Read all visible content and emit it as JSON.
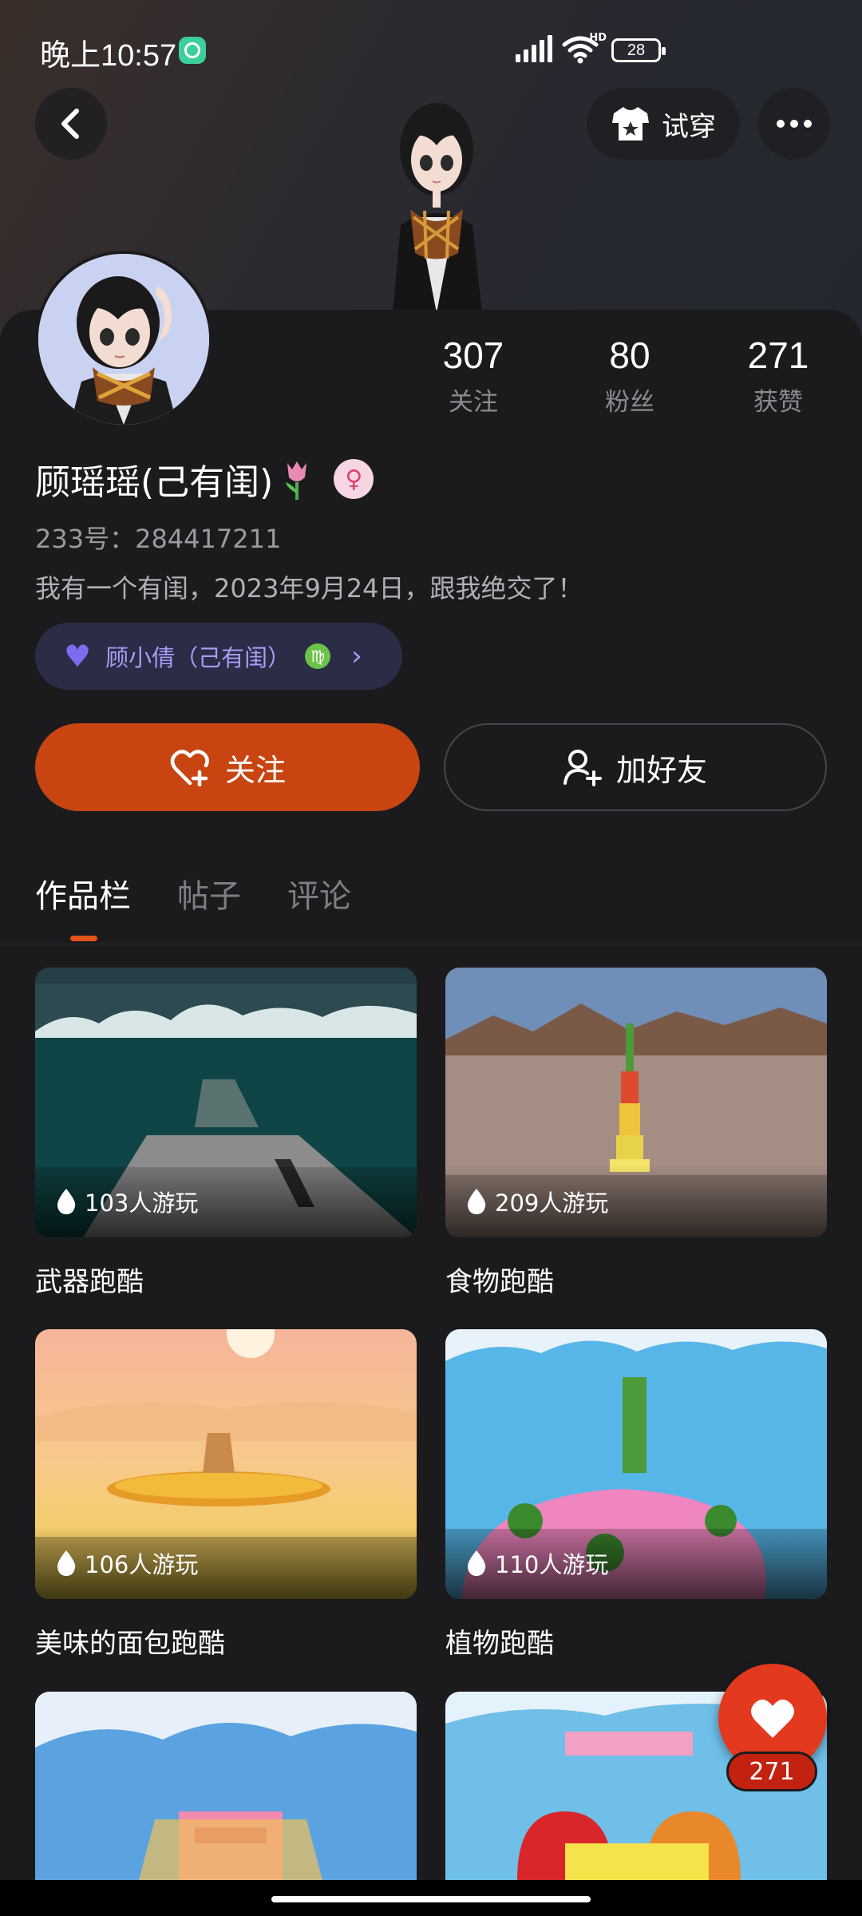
{
  "status": {
    "time": "晚上10:57",
    "network": "HD",
    "battery": "28"
  },
  "header": {
    "tryon_label": "试穿"
  },
  "profile": {
    "name": "顾瑶瑶(己有闺)",
    "uid": "233号：284417211",
    "bio": "我有一个有闺，2023年9月24日，跟我绝交了！",
    "stats": [
      {
        "value": "307",
        "label": "关注"
      },
      {
        "value": "80",
        "label": "粉丝"
      },
      {
        "value": "271",
        "label": "获赞"
      }
    ],
    "friend_chip": {
      "name": "顾小倩（己有闺）",
      "zodiac": "♍"
    }
  },
  "actions": {
    "follow_label": "关注",
    "add_friend_label": "加好友"
  },
  "tabs": [
    {
      "label": "作品栏",
      "active": true
    },
    {
      "label": "帖子",
      "active": false
    },
    {
      "label": "评论",
      "active": false
    }
  ],
  "works": [
    {
      "title": "武器跑酷",
      "plays": "103人游玩"
    },
    {
      "title": "食物跑酷",
      "plays": "209人游玩"
    },
    {
      "title": "美味的面包跑酷",
      "plays": "106人游玩"
    },
    {
      "title": "植物跑酷",
      "plays": "110人游玩"
    }
  ],
  "like": {
    "count": "271"
  },
  "colors": {
    "accent": "#c84512",
    "like": "#e2391f",
    "chip_bg": "#2b2c45"
  }
}
